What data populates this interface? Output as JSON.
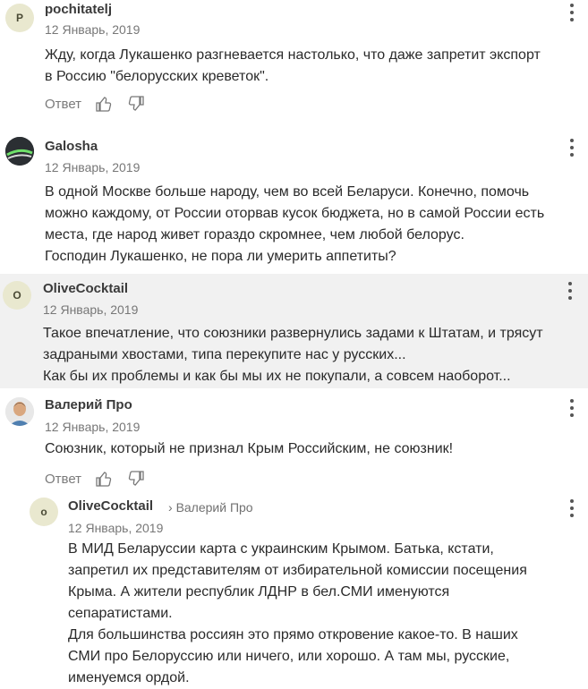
{
  "comments": [
    {
      "author": "pochitatelj",
      "avatar_letter": "P",
      "date": "12 Январь, 2019",
      "lines": [
        "Жду, когда Лукашенко разгневается настолько, что даже запретит экспорт",
        "в Россию \"белорусских креветок\"."
      ],
      "reply_label": "Ответ"
    },
    {
      "author": "Galosha",
      "date": "12 Январь, 2019",
      "lines": [
        "В одной Москве больше народу, чем во всей Беларуси. Конечно, помочь",
        "можно каждому, от России оторвав кусок бюджета, но в самой России есть",
        "места, где народ живет гораздо скромнее, чем любой белорус.",
        "Господин Лукашенко, не пора ли умерить аппетиты?"
      ]
    },
    {
      "author": "OliveCocktail",
      "avatar_letter": "O",
      "date": "12 Январь, 2019",
      "lines": [
        "Такое впечатление, что союзники развернулись задами к Штатам, и трясут",
        "задраными хвостами, типа перекупите нас у русских...",
        "Как бы их проблемы и как бы мы их не покупали, а совсем наоборот..."
      ]
    },
    {
      "author": "Валерий Про",
      "date": "12 Январь, 2019",
      "lines": [
        "Союзник, который не признал Крым Российским, не союзник!"
      ],
      "reply_label": "Ответ"
    },
    {
      "author": "OliveCocktail",
      "avatar_letter": "o",
      "reply_to": "Валерий Про",
      "date": "12 Январь, 2019",
      "lines": [
        "В МИД Беларуссии карта с украинским Крымом. Батька, кстати,",
        "запретил их представителям от избирательной комиссии посещения",
        "Крыма. А жители республик ЛДНР в бел.СМИ именуются",
        "сепаратистами.",
        "Для большинства россиян это прямо откровение какое-то. В наших",
        "СМИ про Белоруссию или ничего, или хорошо. А там мы, русские,",
        "именуемся ордой."
      ]
    }
  ]
}
